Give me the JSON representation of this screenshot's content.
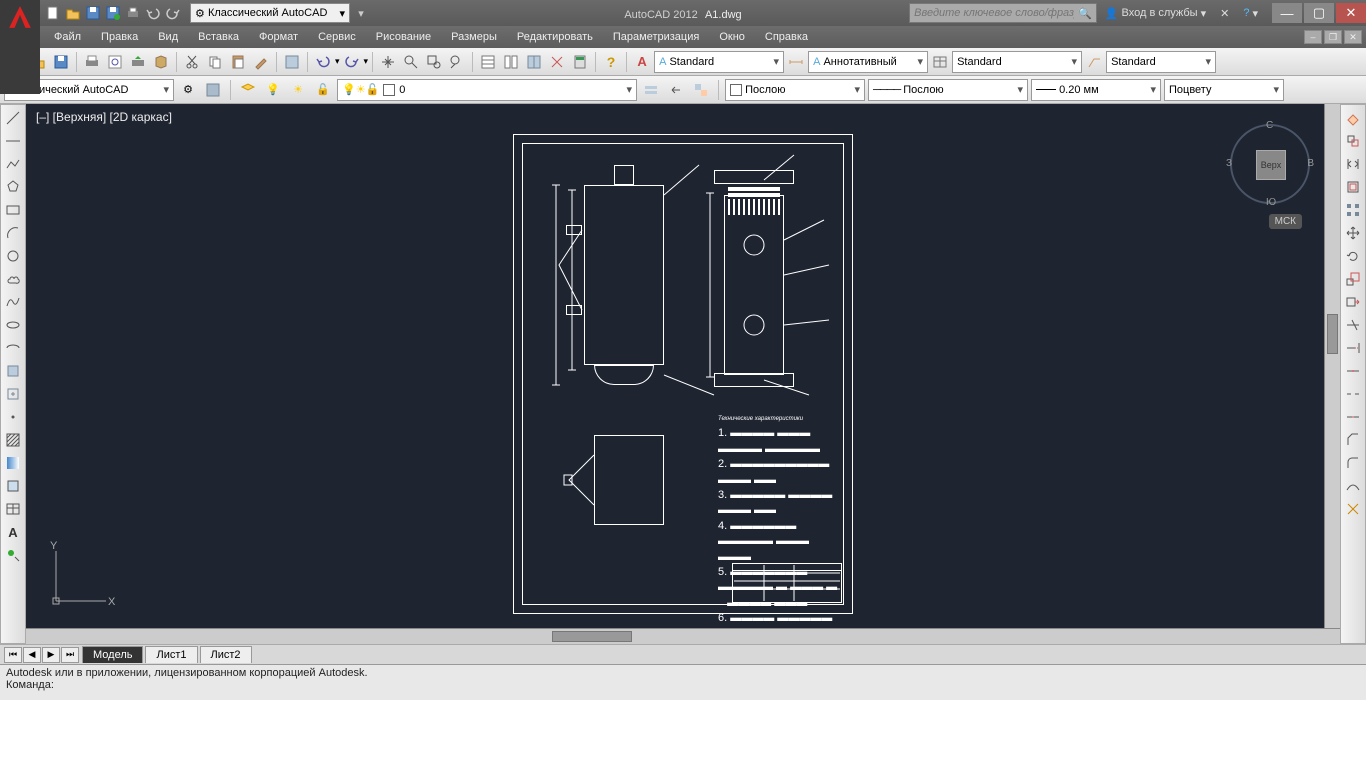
{
  "app": {
    "title_app": "AutoCAD 2012",
    "title_file": "A1.dwg"
  },
  "qat_workspace": "Классический AutoCAD",
  "search": {
    "placeholder": "Введите ключевое слово/фразу"
  },
  "signin": "Вход в службы",
  "menu": [
    "Файл",
    "Правка",
    "Вид",
    "Вставка",
    "Формат",
    "Сервис",
    "Рисование",
    "Размеры",
    "Редактировать",
    "Параметризация",
    "Окно",
    "Справка"
  ],
  "styles": {
    "text": "Standard",
    "dim": "Аннотативный",
    "table": "Standard",
    "mleader": "Standard"
  },
  "workspace_combo": "Классический AutoCAD",
  "layer": {
    "name": "0"
  },
  "props": {
    "color": "Послою",
    "ltype": "Послою",
    "lweight": "0.20 мм",
    "plot": "Поцвету"
  },
  "view": {
    "label": "[–] [Верхняя] [2D каркас]"
  },
  "viewcube": {
    "top": "Верх",
    "n": "С",
    "s": "Ю",
    "e": "В",
    "w": "З",
    "wcs": "МСК"
  },
  "tabs": {
    "model": "Модель",
    "l1": "Лист1",
    "l2": "Лист2"
  },
  "cmd": {
    "line1": "Autodesk или в приложении, лицензированном корпорацией Autodesk.",
    "line2": "Команда:"
  }
}
